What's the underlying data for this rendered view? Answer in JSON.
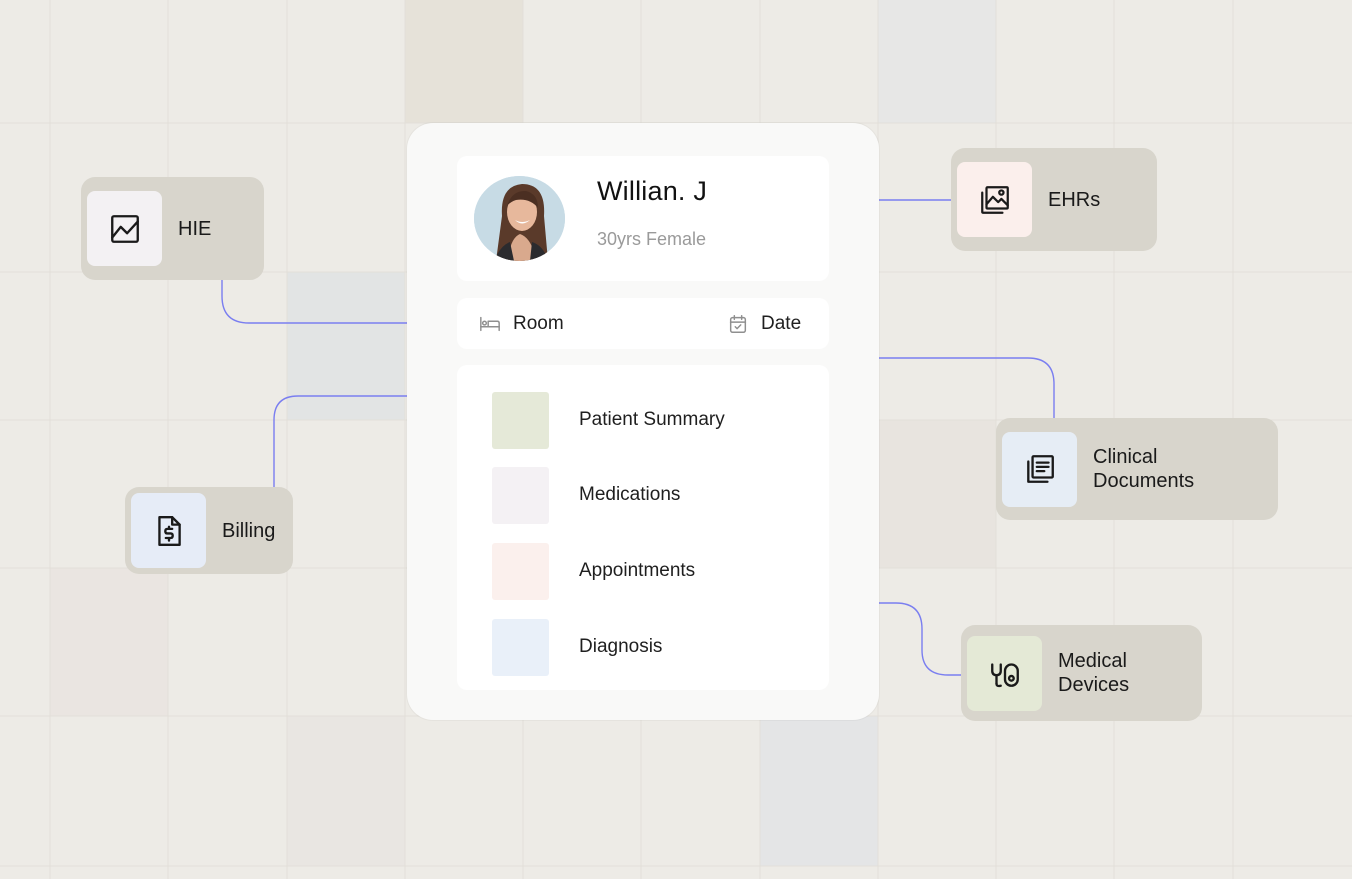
{
  "patient": {
    "name": "Willian. J",
    "details": "30yrs Female"
  },
  "meta": {
    "room_label": "Room",
    "date_label": "Date"
  },
  "records": [
    {
      "label": "Patient Summary",
      "color": "#e5e9d8"
    },
    {
      "label": "Medications",
      "color": "#f4f1f4"
    },
    {
      "label": "Appointments",
      "color": "#fbf0ed"
    },
    {
      "label": "Diagnosis",
      "color": "#e9f0f9"
    }
  ],
  "nodes": {
    "hie": {
      "label": "HIE",
      "icon": "chart-image-icon",
      "color": "#f3f1f3"
    },
    "billing": {
      "label": "Billing",
      "icon": "invoice-dollar-icon",
      "color": "#e6ecf7"
    },
    "ehrs": {
      "label": "EHRs",
      "icon": "photo-folder-icon",
      "color": "#fbefec"
    },
    "clinical_documents": {
      "label_line1": "Clinical",
      "label_line2": "Documents",
      "icon": "document-list-icon",
      "color": "#e6edf5"
    },
    "medical_devices": {
      "label_line1": "Medical",
      "label_line2": "Devices",
      "icon": "stethoscope-icon",
      "color": "#e4e9d6"
    }
  },
  "colors": {
    "connector": "#7a7ef0",
    "node_bg": "#d8d5cc",
    "background": "#edebe6"
  }
}
